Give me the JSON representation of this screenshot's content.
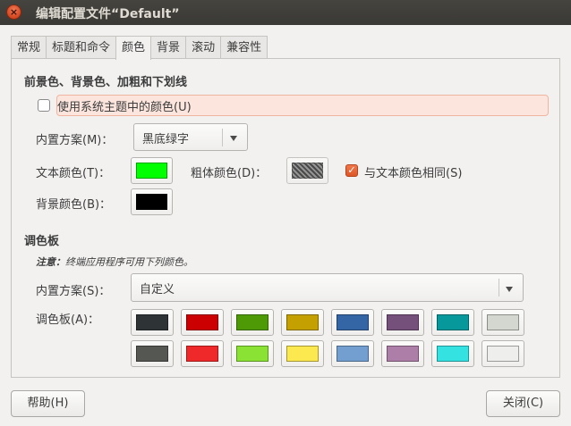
{
  "window": {
    "title": "编辑配置文件“Default”",
    "close_glyph": "×"
  },
  "tabs": [
    {
      "label": "常规"
    },
    {
      "label": "标题和命令"
    },
    {
      "label": "颜色"
    },
    {
      "label": "背景"
    },
    {
      "label": "滚动"
    },
    {
      "label": "兼容性"
    }
  ],
  "active_tab": "颜色",
  "fg_bg": {
    "section_title": "前景色、背景色、加粗和下划线",
    "use_system_theme": {
      "label": "使用系统主题中的颜色(U)",
      "checked": false
    },
    "builtin_scheme": {
      "label": "内置方案(M)：",
      "value": "黑底绿字"
    },
    "text_color": {
      "label": "文本颜色(T)：",
      "color": "#00ff00"
    },
    "bold_color": {
      "label": "粗体颜色(D)：",
      "color": "#000000"
    },
    "same_as_text": {
      "label": "与文本颜色相同(S)",
      "checked": true,
      "mark": "✓"
    },
    "background_color": {
      "label": "背景颜色(B)：",
      "color": "#000000"
    }
  },
  "palette": {
    "section_title": "调色板",
    "note_prefix": "注意：",
    "note_text": "终端应用程序可用下列颜色。",
    "builtin_scheme": {
      "label": "内置方案(S)：",
      "value": "自定义"
    },
    "palette_label": "调色板(A)：",
    "row1": [
      "#2e3436",
      "#cc0000",
      "#4e9a06",
      "#c4a000",
      "#3465a4",
      "#75507b",
      "#06989a",
      "#d3d7cf"
    ],
    "row2": [
      "#555753",
      "#ef2929",
      "#8ae234",
      "#fce94f",
      "#729fcf",
      "#ad7fa8",
      "#34e2e2",
      "#eeeeec"
    ]
  },
  "footer": {
    "help_label": "帮助(H)",
    "close_label": "关闭(C)"
  }
}
